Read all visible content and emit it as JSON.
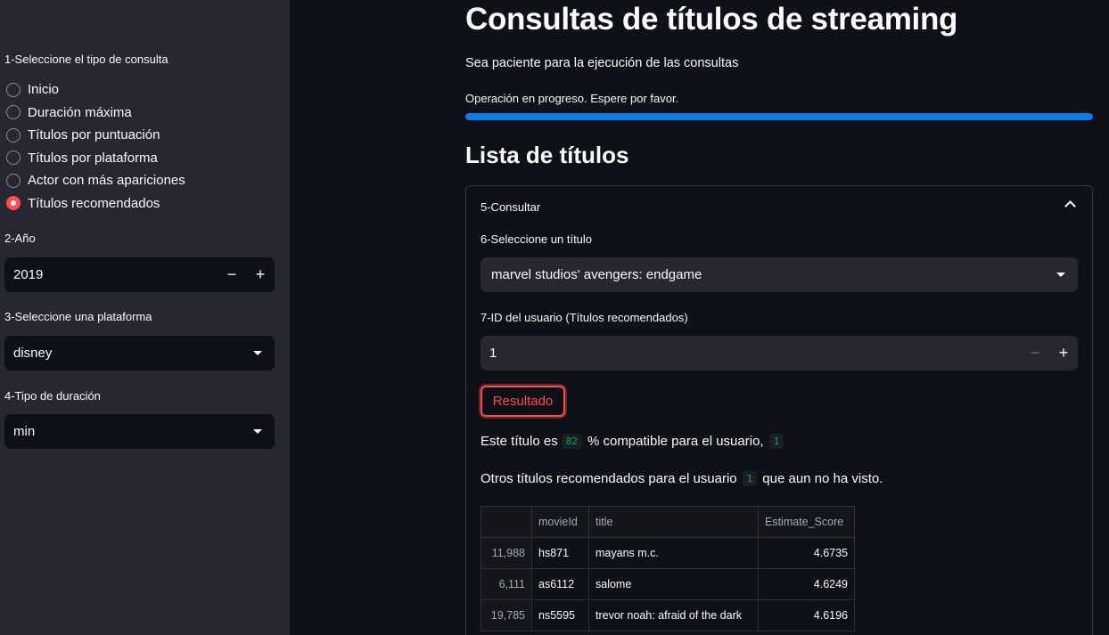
{
  "sidebar": {
    "query_type_label": "1-Seleccione el tipo de consulta",
    "radio_options": [
      {
        "label": "Inicio",
        "selected": false
      },
      {
        "label": "Duración máxima",
        "selected": false
      },
      {
        "label": "Títulos por puntuación",
        "selected": false
      },
      {
        "label": "Títulos por plataforma",
        "selected": false
      },
      {
        "label": "Actor con más apariciones",
        "selected": false
      },
      {
        "label": "Títulos recomendados",
        "selected": true
      }
    ],
    "year_label": "2-Año",
    "year_value": "2019",
    "platform_label": "3-Seleccione una plataforma",
    "platform_value": "disney",
    "duration_label": "4-Tipo de duración",
    "duration_value": "min",
    "minus": "−",
    "plus": "+"
  },
  "main": {
    "title": "Consultas de títulos de streaming",
    "subtitle": "Sea paciente para la ejecución de las consultas",
    "progress_text": "Operación en progreso. Espere por favor.",
    "progress_percent": 100,
    "section_title": "Lista de títulos",
    "expander": {
      "header": "5-Consultar",
      "title_select_label": "6-Seleccione un título",
      "title_select_value": "marvel studios' avengers: endgame",
      "user_id_label": "7-ID del usuario (Títulos recomendados)",
      "user_id_value": "1",
      "result_button": "Resultado",
      "compat_prefix": "Este título es",
      "compat_value": "82",
      "compat_suffix": "% compatible para el usuario,",
      "compat_user": "1",
      "others_prefix": "Otros títulos recomendados para el usuario",
      "others_user": "1",
      "others_suffix": "que aun no ha visto.",
      "table": {
        "columns": [
          "",
          "movieId",
          "title",
          "Estimate_Score"
        ],
        "rows": [
          {
            "index": "11,988",
            "movieId": "hs871",
            "title": "mayans m.c.",
            "score": "4.6735"
          },
          {
            "index": "6,111",
            "movieId": "as6112",
            "title": "salome",
            "score": "4.6249"
          },
          {
            "index": "19,785",
            "movieId": "ns5595",
            "title": "trevor noah: afraid of the dark",
            "score": "4.6196"
          }
        ]
      }
    }
  },
  "colors": {
    "background": "#0e1117",
    "sidebar": "#262730",
    "accent": "#ff4b4b",
    "progress": "#0a7ce8",
    "code_text": "#09ab3b"
  }
}
